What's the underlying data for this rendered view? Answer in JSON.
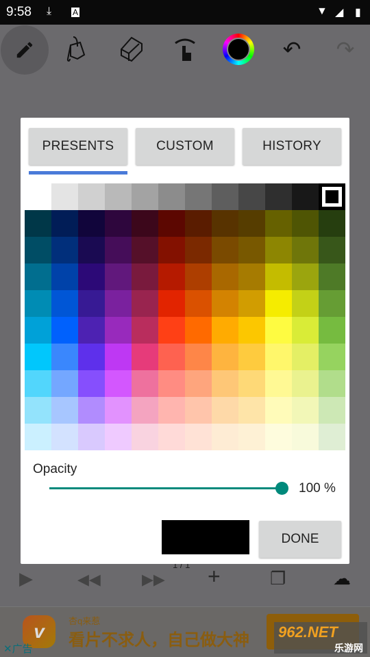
{
  "status_bar": {
    "time": "9:58",
    "icons": [
      "download-icon",
      "text-a-icon",
      "wifi-icon",
      "signal-icon",
      "battery-charging-icon"
    ]
  },
  "toolbar": {
    "tools": [
      "pencil-icon",
      "paint-bucket-icon",
      "eraser-icon",
      "hand-rotate-icon",
      "color-wheel-icon",
      "undo-icon",
      "redo-icon"
    ],
    "current_color": "#000000"
  },
  "dialog": {
    "tabs": [
      {
        "label": "PRESENTS",
        "active": true
      },
      {
        "label": "CUSTOM"
      },
      {
        "label": "HISTORY"
      }
    ],
    "accent": "#4a7bd9",
    "selected_color": "#000000",
    "palette": [
      [
        "#ffffff",
        "#e4e4e4",
        "#d0d0d0",
        "#b9b9b9",
        "#a3a3a3",
        "#8c8c8c",
        "#767676",
        "#5e5e5e",
        "#474747",
        "#2f2f2f",
        "#181818",
        "#000000"
      ],
      [
        "#003748",
        "#011d57",
        "#11053b",
        "#2e063d",
        "#3c071b",
        "#5c0701",
        "#5a1c00",
        "#583300",
        "#563d00",
        "#666100",
        "#4f5504",
        "#263e0f"
      ],
      [
        "#004d65",
        "#012f7b",
        "#1a0a52",
        "#450d59",
        "#551029",
        "#831100",
        "#7b2900",
        "#7a4a00",
        "#785800",
        "#8d8602",
        "#6f760a",
        "#38571a"
      ],
      [
        "#016e8f",
        "#0042a9",
        "#2c0977",
        "#61187c",
        "#791a3d",
        "#b51a00",
        "#ad3e00",
        "#a96800",
        "#a67b01",
        "#c4bc00",
        "#9ba50e",
        "#4e7a27"
      ],
      [
        "#008cb4",
        "#0056d6",
        "#371a94",
        "#7a219e",
        "#99244f",
        "#e22400",
        "#da5100",
        "#d38301",
        "#d19d01",
        "#f5ec00",
        "#c3d117",
        "#669d34"
      ],
      [
        "#00a1d8",
        "#0061fd",
        "#4d22b2",
        "#982abc",
        "#b92d5d",
        "#ff4015",
        "#ff6a00",
        "#ffab01",
        "#fcc700",
        "#fefb41",
        "#d9ec37",
        "#76bb40"
      ],
      [
        "#01c7fc",
        "#3a87fd",
        "#5e30eb",
        "#be38f3",
        "#e63b7a",
        "#fe6250",
        "#fe8648",
        "#feb43f",
        "#fecb3e",
        "#fff76b",
        "#e4ef65",
        "#96d35f"
      ],
      [
        "#52d6fc",
        "#74a7ff",
        "#864ffd",
        "#d357fe",
        "#ee719e",
        "#ff8c82",
        "#fea57d",
        "#fec777",
        "#fed977",
        "#fff994",
        "#eaf28f",
        "#b1dd8b"
      ],
      [
        "#93e3fc",
        "#a7c6ff",
        "#b18cfe",
        "#e292fe",
        "#f4a4c0",
        "#ffb5af",
        "#ffc5ab",
        "#fed9a8",
        "#fee4a8",
        "#fffbb9",
        "#f2f7b7",
        "#cde8b5"
      ],
      [
        "#cbf0ff",
        "#d3e2ff",
        "#d9c9fe",
        "#efcaff",
        "#f9d3e0",
        "#ffdad8",
        "#ffe2d6",
        "#feecd4",
        "#fef1d5",
        "#fefcdd",
        "#f8fadb",
        "#dfeed4"
      ]
    ],
    "opacity": {
      "label": "Opacity",
      "value": 100,
      "value_text": "100 %",
      "color": "#00897b"
    },
    "done_label": "DONE"
  },
  "bottom_bar": {
    "page_indicator": "1 / 1",
    "icons": [
      "play-icon",
      "rewind-icon",
      "fast-forward-icon",
      "add-icon",
      "copy-icon",
      "cloud-upload-icon"
    ]
  },
  "ad": {
    "small": "杏q来惹",
    "headline": "看片不求人，自己做大神",
    "close_label": "广告",
    "watermark": "962.NET",
    "watermark_sub": "乐游网"
  }
}
